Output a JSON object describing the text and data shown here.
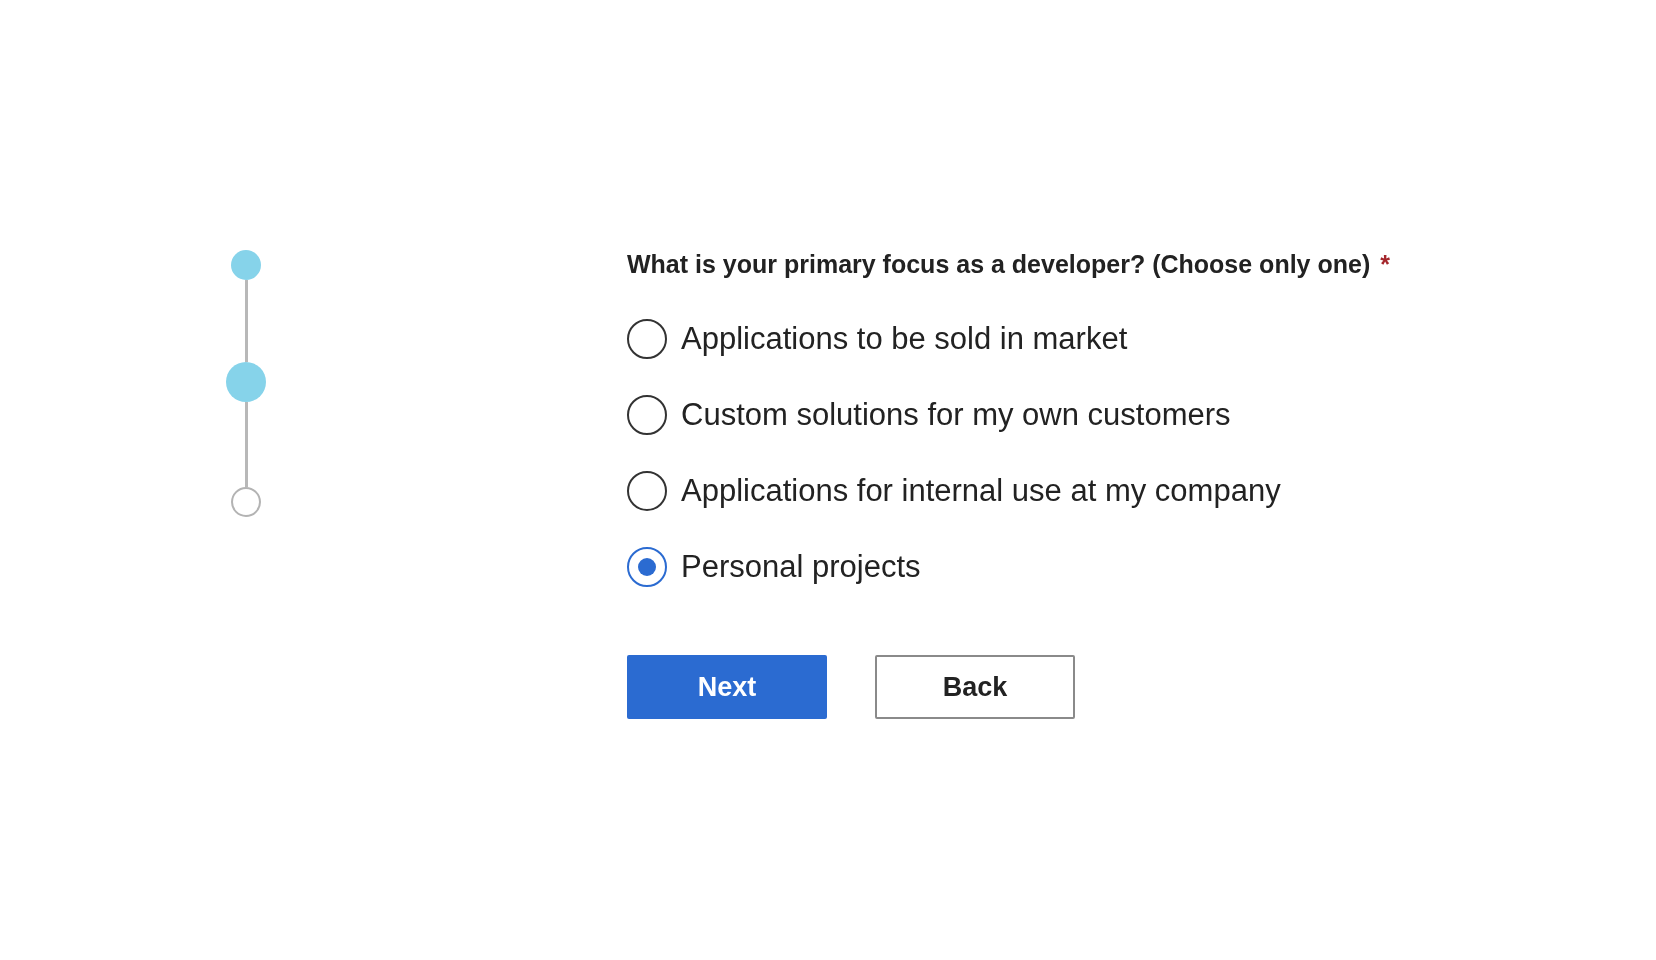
{
  "steps": [
    {
      "kind": "done"
    },
    {
      "kind": "current"
    },
    {
      "kind": "upcoming"
    }
  ],
  "question": {
    "text": "What is your primary focus as a developer? (Choose only one)",
    "required_mark": "*"
  },
  "options": [
    {
      "label": "Applications to be sold in market",
      "selected": false
    },
    {
      "label": "Custom solutions for my own customers",
      "selected": false
    },
    {
      "label": "Applications for internal use at my company",
      "selected": false
    },
    {
      "label": "Personal projects",
      "selected": true
    }
  ],
  "buttons": [
    {
      "label": "Next",
      "kind": "primary"
    },
    {
      "label": "Back",
      "kind": "secondary"
    }
  ]
}
